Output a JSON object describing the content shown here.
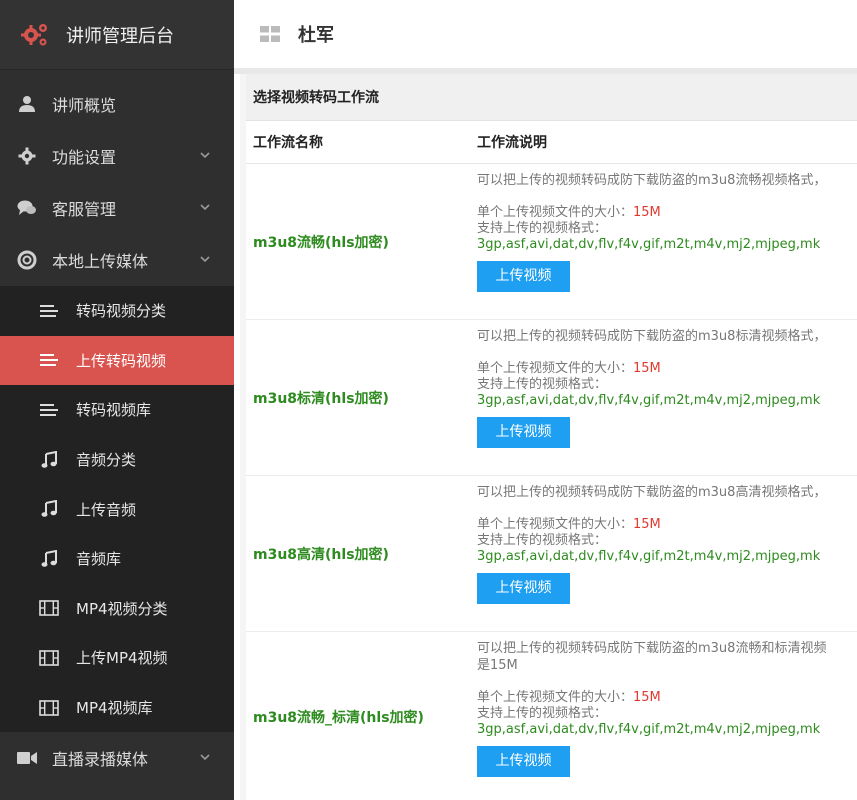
{
  "app": {
    "brand_title": "讲师管理后台",
    "user_name": "杜军"
  },
  "sidebar": {
    "items": [
      {
        "label": "讲师概览",
        "icon": "user-icon",
        "has_chevron": false
      },
      {
        "label": "功能设置",
        "icon": "gear-icon",
        "has_chevron": true
      },
      {
        "label": "客服管理",
        "icon": "chat-icon",
        "has_chevron": true
      },
      {
        "label": "本地上传媒体",
        "icon": "lifebuoy-icon",
        "has_chevron": true
      }
    ],
    "subitems": [
      {
        "label": "转码视频分类",
        "icon": "list-icon"
      },
      {
        "label": "上传转码视频",
        "icon": "list-icon",
        "active": true
      },
      {
        "label": "转码视频库",
        "icon": "list-icon"
      },
      {
        "label": "音频分类",
        "icon": "music-icon"
      },
      {
        "label": "上传音频",
        "icon": "music-icon"
      },
      {
        "label": "音频库",
        "icon": "music-icon"
      },
      {
        "label": "MP4视频分类",
        "icon": "film-icon"
      },
      {
        "label": "上传MP4视频",
        "icon": "film-icon"
      },
      {
        "label": "MP4视频库",
        "icon": "film-icon"
      }
    ],
    "bottom_item": {
      "label": "直播录播媒体",
      "icon": "video-camera-icon",
      "has_chevron": true
    }
  },
  "panel": {
    "title": "选择视频转码工作流",
    "col_name": "工作流名称",
    "col_desc": "工作流说明"
  },
  "workflows": [
    {
      "name": "m3u8流畅(hls加密)",
      "intro": "可以把上传的视频转码成防下载防盗的m3u8流畅视频格式，",
      "size_label": "单个上传视频文件的大小：",
      "size_value": "15M",
      "format_label": "支持上传的视频格式：",
      "formats": "3gp,asf,avi,dat,dv,flv,f4v,gif,m2t,m4v,mj2,mjpeg,mk",
      "button": "上传视频"
    },
    {
      "name": "m3u8标清(hls加密)",
      "intro": "可以把上传的视频转码成防下载防盗的m3u8标清视频格式，",
      "size_label": "单个上传视频文件的大小：",
      "size_value": "15M",
      "format_label": "支持上传的视频格式：",
      "formats": "3gp,asf,avi,dat,dv,flv,f4v,gif,m2t,m4v,mj2,mjpeg,mk",
      "button": "上传视频"
    },
    {
      "name": "m3u8高清(hls加密)",
      "intro": "可以把上传的视频转码成防下载防盗的m3u8高清视频格式，",
      "size_label": "单个上传视频文件的大小：",
      "size_value": "15M",
      "format_label": "支持上传的视频格式：",
      "formats": "3gp,asf,avi,dat,dv,flv,f4v,gif,m2t,m4v,mj2,mjpeg,mk",
      "button": "上传视频"
    },
    {
      "name": "m3u8流畅_标清(hls加密)",
      "intro": "可以把上传的视频转码成防下载防盗的m3u8流畅和标清视频",
      "intro2": "是15M",
      "size_label": "单个上传视频文件的大小：",
      "size_value": "15M",
      "format_label": "支持上传的视频格式：",
      "formats": "3gp,asf,avi,dat,dv,flv,f4v,gif,m2t,m4v,mj2,mjpeg,mk",
      "button": "上传视频"
    }
  ],
  "colors": {
    "sidebar_bg": "#2f2f2f",
    "submenu_bg": "#222222",
    "active_item": "#d9534f",
    "workflow_name": "#2e8b1f",
    "size_value": "#e03a2f",
    "button": "#1e9ff2"
  }
}
